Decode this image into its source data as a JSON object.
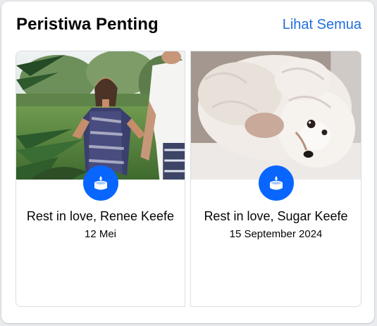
{
  "header": {
    "title": "Peristiwa Penting",
    "see_all_label": "Lihat Semua"
  },
  "events": [
    {
      "title": "Rest in love, Renee Keefe",
      "date": "12 Mei",
      "icon": "candle-icon"
    },
    {
      "title": "Rest in love, Sugar Keefe",
      "date": "15 September 2024",
      "icon": "candle-icon"
    }
  ],
  "colors": {
    "accent": "#0866ff",
    "link": "#216fdb",
    "text": "#050505"
  }
}
